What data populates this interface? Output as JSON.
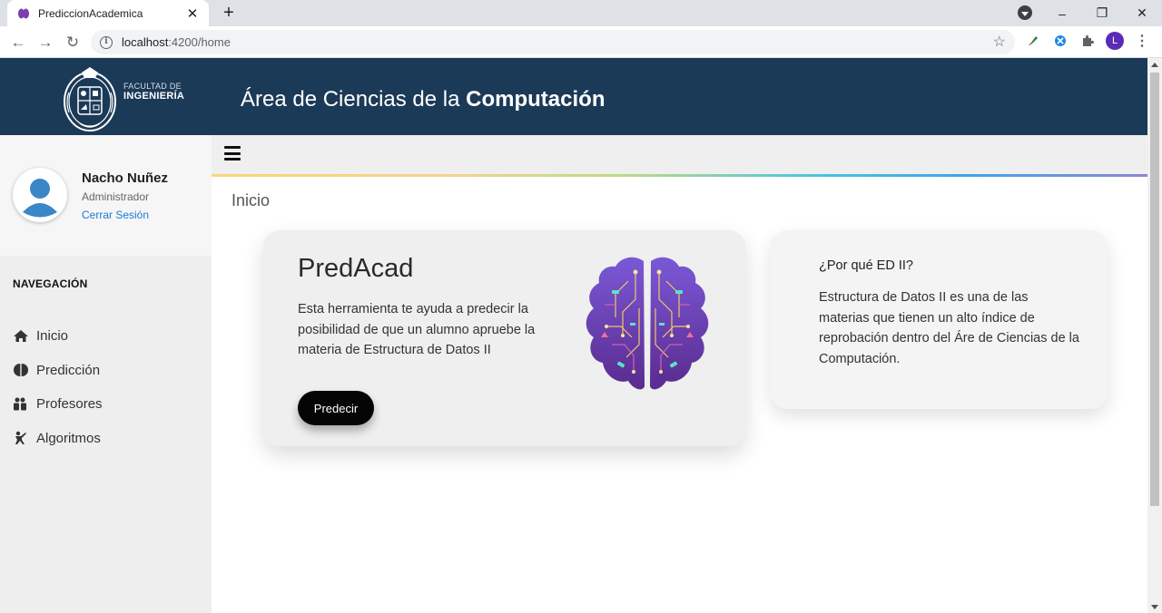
{
  "browser": {
    "tab_title": "PrediccionAcademica",
    "url_host": "localhost",
    "url_path": ":4200/home",
    "profile_initial": "L"
  },
  "header": {
    "logo_line1": "FACULTAD DE",
    "logo_line2": "INGENIERÍA",
    "title_regular": "Área de Ciencias de la",
    "title_bold": "Computación"
  },
  "user": {
    "name": "Nacho Nuñez",
    "role": "Administrador",
    "logout_label": "Cerrar Sesión"
  },
  "sidebar": {
    "heading": "NAVEGACIÓN",
    "items": [
      {
        "label": "Inicio",
        "icon": "home-icon"
      },
      {
        "label": "Predicción",
        "icon": "brain-icon"
      },
      {
        "label": "Profesores",
        "icon": "users-icon"
      },
      {
        "label": "Algoritmos",
        "icon": "person-chalkboard-icon"
      }
    ]
  },
  "breadcrumb": "Inicio",
  "main_card": {
    "title": "PredAcad",
    "text": "Esta herramienta te ayuda a predecir la posibilidad de que un alumno apruebe la materia de Estructura de Datos II",
    "button_label": "Predecir"
  },
  "side_card": {
    "title": "¿Por qué ED II?",
    "text": "Estructura de Datos II es una de las materias que tienen un alto índice de reprobación dentro del Áre de Ciencias de la Computación."
  },
  "colors": {
    "header_bg": "#1b3a57",
    "sidebar_bg": "#eeeeee",
    "button_bg": "#050505",
    "link": "#1a7ad9"
  }
}
